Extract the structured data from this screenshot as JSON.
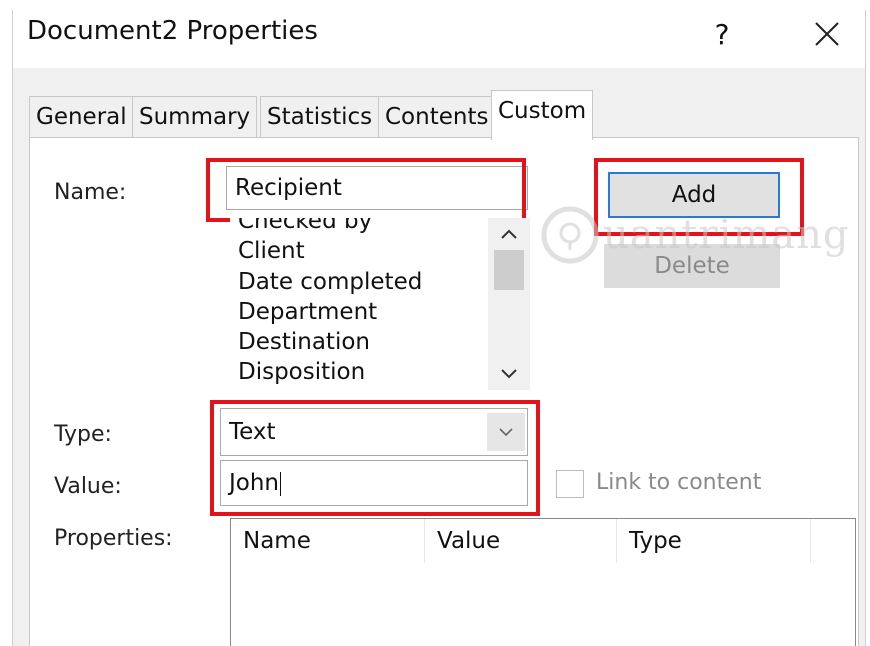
{
  "window": {
    "title": "Document2 Properties",
    "help_label": "?",
    "close_label": "✕"
  },
  "tabs": [
    {
      "label": "General"
    },
    {
      "label": "Summary"
    },
    {
      "label": "Statistics"
    },
    {
      "label": "Contents"
    },
    {
      "label": "Custom",
      "active": true
    }
  ],
  "form": {
    "name_label": "Name:",
    "name_value": "Recipient",
    "names_list": [
      "Checked by",
      "Client",
      "Date completed",
      "Department",
      "Destination",
      "Disposition"
    ],
    "type_label": "Type:",
    "type_value": "Text",
    "value_label": "Value:",
    "value_value": "John",
    "link_label": "Link to content",
    "link_checked": false,
    "properties_label": "Properties:"
  },
  "buttons": {
    "add": "Add",
    "delete": "Delete"
  },
  "properties_table": {
    "columns": [
      "Name",
      "Value",
      "Type"
    ],
    "rows": []
  },
  "watermark": {
    "text": "uantrimang"
  },
  "colors": {
    "highlight": "#e2131b",
    "add_border": "#2a7ad5",
    "disabled_text": "#8a8a8a"
  }
}
